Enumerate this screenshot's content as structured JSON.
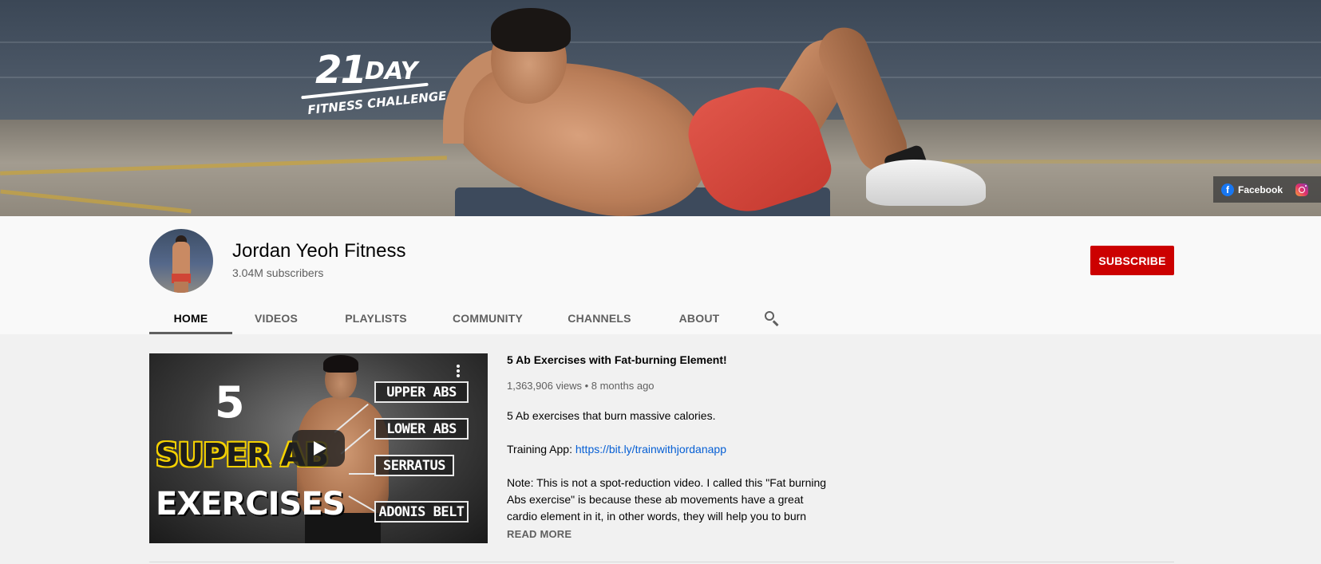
{
  "banner": {
    "logo_number": "21",
    "logo_day": "DAY",
    "logo_subtitle": "FITNESS CHALLENGE",
    "links": [
      {
        "label": "Facebook",
        "icon": "facebook-icon"
      },
      {
        "label": "",
        "icon": "instagram-icon"
      }
    ]
  },
  "channel": {
    "name": "Jordan Yeoh Fitness",
    "subscribers": "3.04M subscribers",
    "subscribe_label": "SUBSCRIBE",
    "subscribe_color": "#cc0000"
  },
  "tabs": [
    {
      "label": "HOME",
      "active": true
    },
    {
      "label": "VIDEOS"
    },
    {
      "label": "PLAYLISTS"
    },
    {
      "label": "COMMUNITY"
    },
    {
      "label": "CHANNELS"
    },
    {
      "label": "ABOUT"
    }
  ],
  "featured": {
    "thumbnail": {
      "number": "5",
      "line1": "SUPER AB",
      "line2": "EXERCISES",
      "labels": [
        "UPPER ABS",
        "LOWER ABS",
        "SERRATUS",
        "ADONIS BELT"
      ]
    },
    "title": "5 Ab Exercises with Fat-burning Element!",
    "views": "1,363,906 views",
    "separator": "•",
    "age": "8 months ago",
    "description": {
      "line1": "5 Ab exercises that burn massive calories.",
      "app_prefix": "Training App: ",
      "app_link": "https://bit.ly/trainwithjordanapp",
      "note1": "Note: This is not a spot-reduction video. I called this \"Fat burning",
      "note2": "Abs exercise\" is because these ab movements have a great",
      "note3": "cardio element in it, in other words, they will help you to burn"
    },
    "read_more": "READ MORE"
  },
  "colors": {
    "accent": "#cc0000",
    "link": "#065fd4",
    "secondary_text": "#606060"
  }
}
